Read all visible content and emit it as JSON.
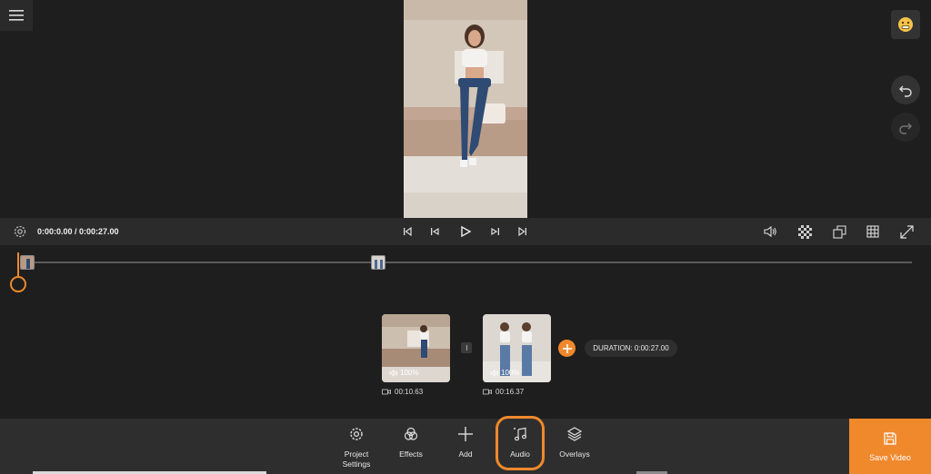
{
  "player": {
    "time": "0:00:0.00 / 0:00:27.00"
  },
  "clips": [
    {
      "volume": "100%",
      "duration": "00:10.63"
    },
    {
      "volume": "100%",
      "duration": "00:16.37"
    }
  ],
  "timeline": {
    "total_duration": "DURATION: 0:00:27.00"
  },
  "toolbar": {
    "project_settings": "Project\nSettings",
    "effects": "Effects",
    "add": "Add",
    "audio": "Audio",
    "overlays": "Overlays",
    "save": "Save Video"
  },
  "colors": {
    "accent": "#f0882c",
    "background": "#1e1e1e",
    "bar": "#2b2b2b"
  },
  "icons": [
    "menu-icon",
    "emoji-icon",
    "undo-icon",
    "redo-icon",
    "settings-gear-icon",
    "skip-start-icon",
    "step-back-icon",
    "play-icon",
    "step-forward-icon",
    "skip-end-icon",
    "volume-icon",
    "checker-bg-icon",
    "aspect-ratio-icon",
    "grid-icon",
    "fullscreen-icon",
    "video-camera-icon",
    "plus-icon",
    "music-note-icon",
    "layers-icon",
    "save-disk-icon"
  ]
}
